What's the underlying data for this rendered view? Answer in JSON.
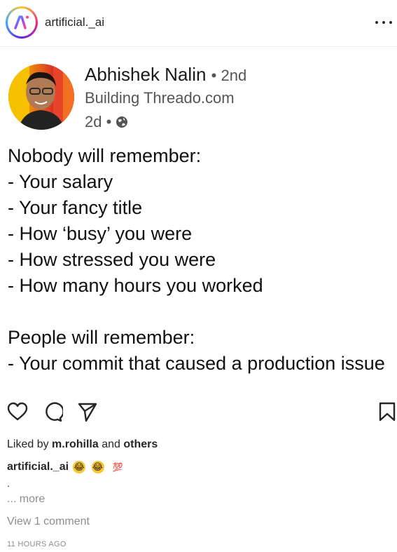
{
  "header": {
    "username": "artificial._ai",
    "logo_icon": "ai-gradient-logo-icon",
    "more_icon": "more-horizontal-icon"
  },
  "post": {
    "author": {
      "name": "Abhishek Nalin",
      "degree": "• 2nd",
      "headline": "Building Threado.com",
      "time": "2d •",
      "visibility_icon": "globe-icon"
    },
    "lines": [
      "Nobody will remember:",
      "- Your salary",
      "- Your fancy title",
      "- How ‘busy’ you were",
      "- How stressed you were",
      "- How many hours you worked",
      "",
      "People will remember:",
      "- Your commit that caused a production issue"
    ]
  },
  "actions": {
    "like_icon": "heart-icon",
    "comment_icon": "comment-bubble-icon",
    "share_icon": "paper-plane-icon",
    "save_icon": "bookmark-icon"
  },
  "likes": {
    "prefix": "Liked by",
    "user": "m.rohilla",
    "and": "and",
    "others": "others"
  },
  "caption": {
    "username": "artificial._ai",
    "emojis": [
      "😂",
      "😂",
      "💯"
    ],
    "dot": ".",
    "more": "... more"
  },
  "comments": {
    "view_label": "View 1 comment"
  },
  "timestamp": "11 HOURS AGO",
  "colors": {
    "text": "#262626",
    "muted": "#8e8e8e",
    "border": "#efefef"
  }
}
